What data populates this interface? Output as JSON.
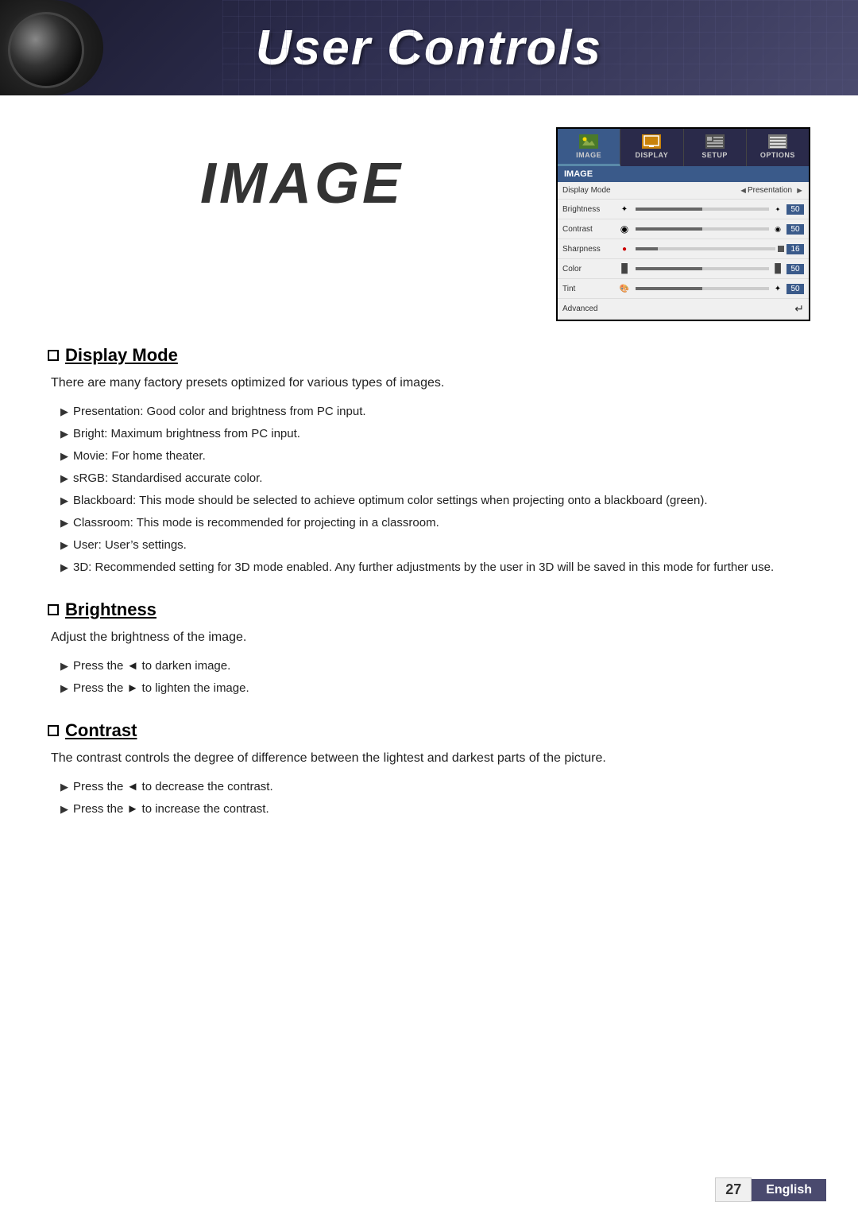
{
  "header": {
    "title": "User Controls"
  },
  "osd": {
    "tabs": [
      {
        "label": "IMAGE",
        "active": true
      },
      {
        "label": "DISPLAY",
        "active": false
      },
      {
        "label": "SETUP",
        "active": false
      },
      {
        "label": "OPTIONS",
        "active": false
      }
    ],
    "section_header": "IMAGE",
    "rows": [
      {
        "label": "Display Mode",
        "type": "select",
        "value": "Presentation",
        "has_arrows": true
      },
      {
        "label": "Brightness",
        "type": "slider",
        "value": 50
      },
      {
        "label": "Contrast",
        "type": "slider",
        "value": 50
      },
      {
        "label": "Sharpness",
        "type": "slider",
        "value": 16
      },
      {
        "label": "Color",
        "type": "slider",
        "value": 50
      },
      {
        "label": "Tint",
        "type": "slider",
        "value": 50
      },
      {
        "label": "Advanced",
        "type": "enter"
      }
    ]
  },
  "image_section": {
    "title": "IMAGE"
  },
  "sections": [
    {
      "id": "display-mode",
      "title": "Display Mode",
      "description": "There are many factory presets optimized for various types of images.",
      "bullets": [
        "Presentation: Good color and brightness from PC input.",
        "Bright: Maximum brightness from PC input.",
        "Movie: For home theater.",
        "sRGB: Standardised accurate color.",
        "Blackboard: This mode should be selected to achieve optimum color settings when projecting onto a blackboard (green).",
        "Classroom: This mode is recommended for projecting in a classroom.",
        "User: User’s settings.",
        "3D: Recommended setting for 3D mode enabled. Any further adjustments by the user in 3D will be saved in this mode for further use."
      ]
    },
    {
      "id": "brightness",
      "title": "Brightness",
      "description": "Adjust the brightness of the image.",
      "bullets": [
        "Press the ◄ to darken image.",
        "Press the ► to lighten the image."
      ]
    },
    {
      "id": "contrast",
      "title": "Contrast",
      "description": "The contrast controls the degree of difference between the lightest and darkest parts of the picture.",
      "bullets": [
        "Press the ◄ to decrease the contrast.",
        "Press the ► to increase the contrast."
      ]
    }
  ],
  "footer": {
    "page_number": "27",
    "language": "English"
  }
}
